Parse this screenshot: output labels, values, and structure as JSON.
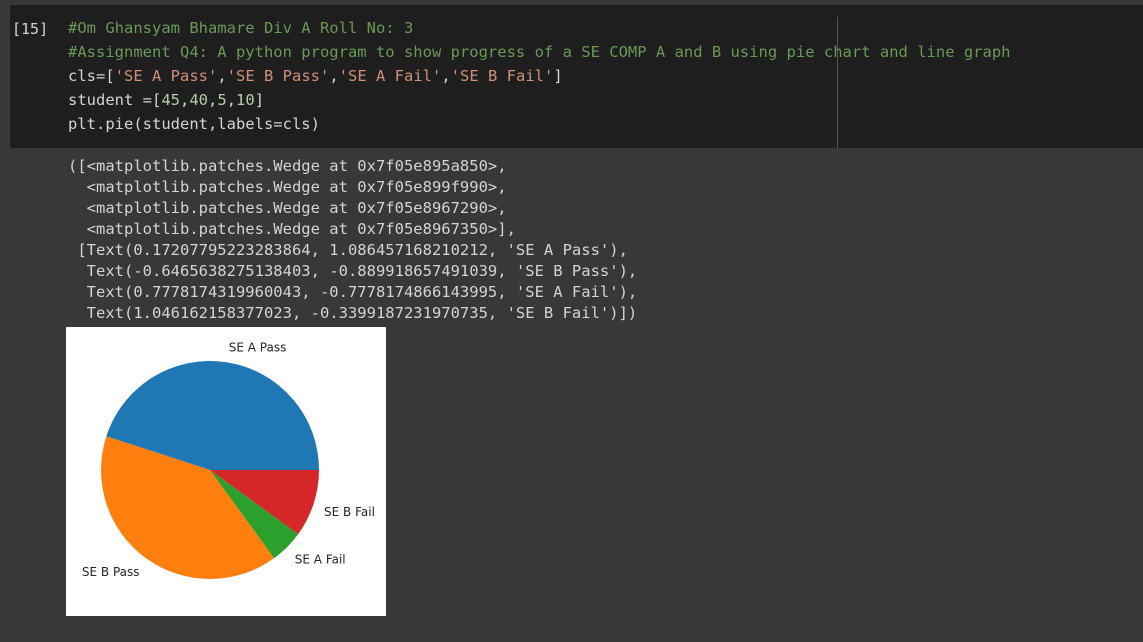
{
  "cell": {
    "prompt": "[15]",
    "code_lines": [
      {
        "parts": [
          {
            "c": "cm",
            "t": "#Om Ghansyam Bhamare Div A Roll No: 3"
          }
        ]
      },
      {
        "parts": [
          {
            "c": "cm",
            "t": "#Assignment Q4: A python program to show progress of a SE COMP A and B using pie chart and line graph"
          }
        ]
      },
      {
        "parts": [
          {
            "c": "tx",
            "t": "cls=["
          },
          {
            "c": "st",
            "t": "'SE A Pass'"
          },
          {
            "c": "tx",
            "t": ","
          },
          {
            "c": "st",
            "t": "'SE B Pass'"
          },
          {
            "c": "tx",
            "t": ","
          },
          {
            "c": "st",
            "t": "'SE A Fail'"
          },
          {
            "c": "tx",
            "t": ","
          },
          {
            "c": "st",
            "t": "'SE B Fail'"
          },
          {
            "c": "tx",
            "t": "]"
          }
        ]
      },
      {
        "parts": [
          {
            "c": "tx",
            "t": "student =["
          },
          {
            "c": "nm",
            "t": "45"
          },
          {
            "c": "tx",
            "t": ","
          },
          {
            "c": "nm",
            "t": "40"
          },
          {
            "c": "tx",
            "t": ","
          },
          {
            "c": "nm",
            "t": "5"
          },
          {
            "c": "tx",
            "t": ","
          },
          {
            "c": "nm",
            "t": "10"
          },
          {
            "c": "tx",
            "t": "]"
          }
        ]
      },
      {
        "parts": [
          {
            "c": "tx",
            "t": "plt.pie(student,labels=cls)"
          }
        ]
      }
    ]
  },
  "output": {
    "lines": [
      "([<matplotlib.patches.Wedge at 0x7f05e895a850>,",
      "  <matplotlib.patches.Wedge at 0x7f05e899f990>,",
      "  <matplotlib.patches.Wedge at 0x7f05e8967290>,",
      "  <matplotlib.patches.Wedge at 0x7f05e8967350>],",
      " [Text(0.17207795223283864, 1.086457168210212, 'SE A Pass'),",
      "  Text(-0.6465638275138403, -0.889918657491039, 'SE B Pass'),",
      "  Text(0.7778174319960043, -0.7778174866143995, 'SE A Fail'),",
      "  Text(1.046162158377023, -0.3399187231970735, 'SE B Fail')])"
    ]
  },
  "chart_data": {
    "type": "pie",
    "categories": [
      "SE A Pass",
      "SE B Pass",
      "SE A Fail",
      "SE B Fail"
    ],
    "values": [
      45,
      40,
      5,
      10
    ],
    "colors": [
      "#1f77b4",
      "#ff7f0e",
      "#2ca02c",
      "#d62728"
    ],
    "start_angle_deg": 0,
    "direction": "counterclockwise",
    "title": "",
    "legend": "none"
  }
}
